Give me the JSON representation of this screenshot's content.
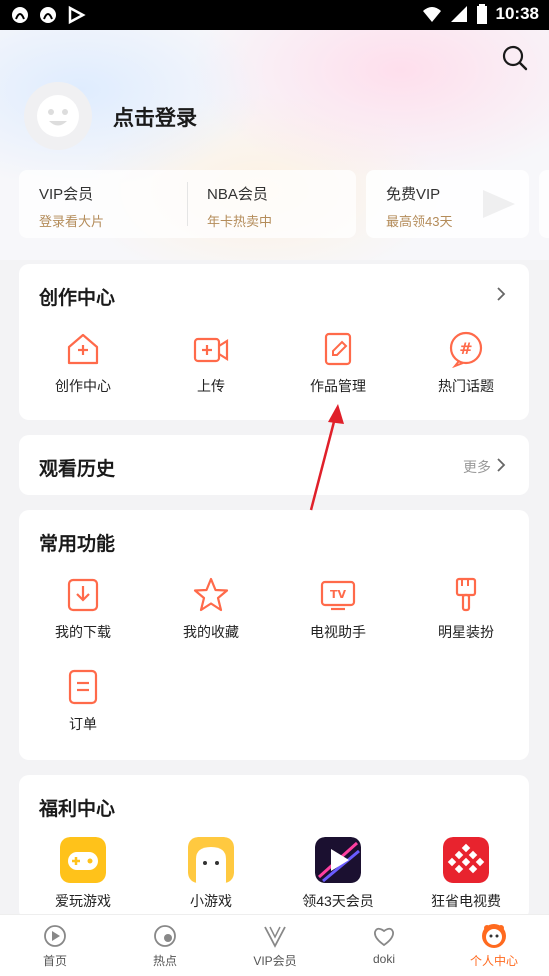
{
  "status_bar": {
    "time": "10:38"
  },
  "header": {
    "login_label": "点击登录"
  },
  "membership": [
    {
      "title": "VIP会员",
      "subtitle": "登录看大片"
    },
    {
      "title": "NBA会员",
      "subtitle": "年卡热卖中"
    },
    {
      "title": "免费VIP",
      "subtitle": "最高领43天"
    }
  ],
  "creation": {
    "title": "创作中心",
    "items": [
      {
        "label": "创作中心",
        "icon": "house-plus-icon"
      },
      {
        "label": "上传",
        "icon": "video-plus-icon"
      },
      {
        "label": "作品管理",
        "icon": "edit-doc-icon"
      },
      {
        "label": "热门话题",
        "icon": "hashtag-icon"
      }
    ]
  },
  "history": {
    "title": "观看历史",
    "more_label": "更多"
  },
  "functions": {
    "title": "常用功能",
    "items": [
      {
        "label": "我的下载",
        "icon": "download-icon"
      },
      {
        "label": "我的收藏",
        "icon": "star-icon"
      },
      {
        "label": "电视助手",
        "icon": "tv-icon"
      },
      {
        "label": "明星装扮",
        "icon": "brush-icon"
      },
      {
        "label": "订单",
        "icon": "order-icon"
      }
    ]
  },
  "welfare": {
    "title": "福利中心",
    "items": [
      {
        "label": "爱玩游戏",
        "icon": "game-app-icon"
      },
      {
        "label": "小游戏",
        "icon": "mini-game-icon"
      },
      {
        "label": "领43天会员",
        "icon": "vip-play-icon"
      },
      {
        "label": "狂省电视费",
        "icon": "tv-save-icon"
      }
    ]
  },
  "bottom_nav": [
    {
      "label": "首页",
      "icon": "home-icon"
    },
    {
      "label": "热点",
      "icon": "hot-icon"
    },
    {
      "label": "VIP会员",
      "icon": "vip-icon"
    },
    {
      "label": "doki",
      "icon": "doki-icon"
    },
    {
      "label": "个人中心",
      "icon": "profile-icon",
      "active": true
    }
  ],
  "colors": {
    "accent": "#ff6a1f",
    "gold": "#b48c5a",
    "annotation": "#e0202a"
  }
}
